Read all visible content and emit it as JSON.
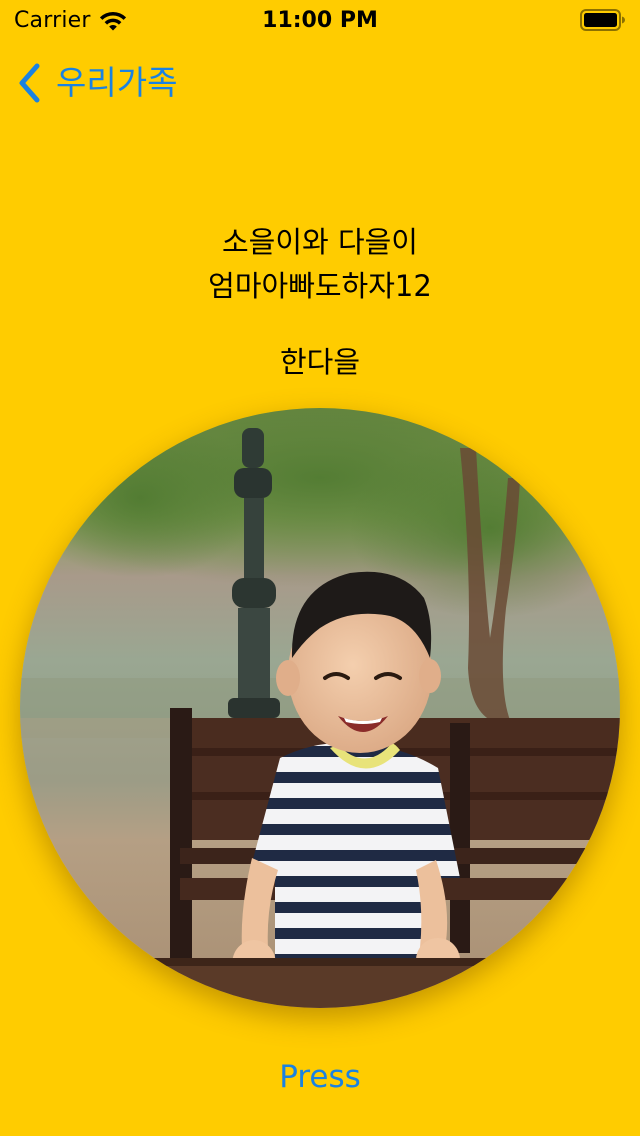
{
  "status_bar": {
    "carrier": "Carrier",
    "time": "11:00 PM",
    "icons": [
      "wifi-icon",
      "battery-icon"
    ]
  },
  "nav": {
    "back_label": "우리가족",
    "back_icon": "chevron-left-icon"
  },
  "content": {
    "name_line1": "소을이와 다을이",
    "name_line2": "엄마아빠도하자12",
    "sub_name": "한다을",
    "photo_description_icon": "child-photo"
  },
  "actions": {
    "press_label": "Press"
  },
  "colors": {
    "background": "#FFCC00",
    "tint": "#1A82E2",
    "text": "#000000"
  }
}
